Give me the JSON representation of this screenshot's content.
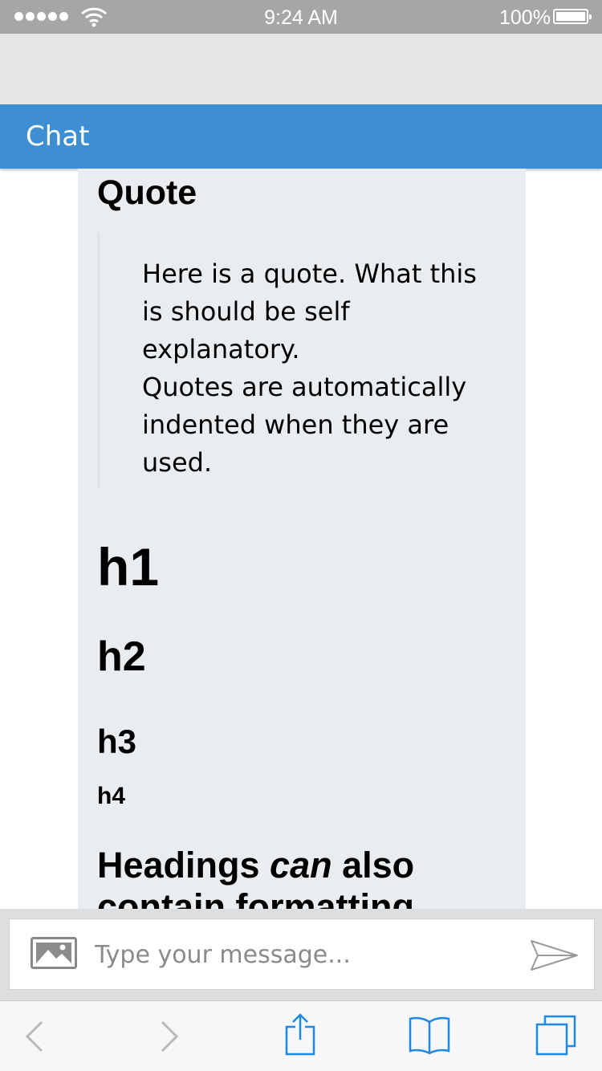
{
  "status_bar": {
    "time": "9:24 AM",
    "battery_percent": "100%",
    "signal_bars": 5
  },
  "app": {
    "title": "Chat"
  },
  "message": {
    "quote_heading": "Quote",
    "quote_text": "Here is a quote. What this is should be self explanatory.\nQuotes are automatically indented when they are used.",
    "h1": "h1",
    "h2": "h2",
    "h3": "h3",
    "h4": "h4",
    "formatted_heading_before": "Headings ",
    "formatted_heading_em": "can",
    "formatted_heading_after": " also contain formatting"
  },
  "composer": {
    "placeholder": "Type your message..."
  },
  "colors": {
    "header": "#3e8fd2",
    "card": "#eaedf0",
    "icon_blue": "#1f88e5"
  },
  "icons": [
    "wifi-icon",
    "image-icon",
    "send-icon",
    "back-icon",
    "forward-icon",
    "share-icon",
    "bookmarks-icon",
    "tabs-icon"
  ]
}
